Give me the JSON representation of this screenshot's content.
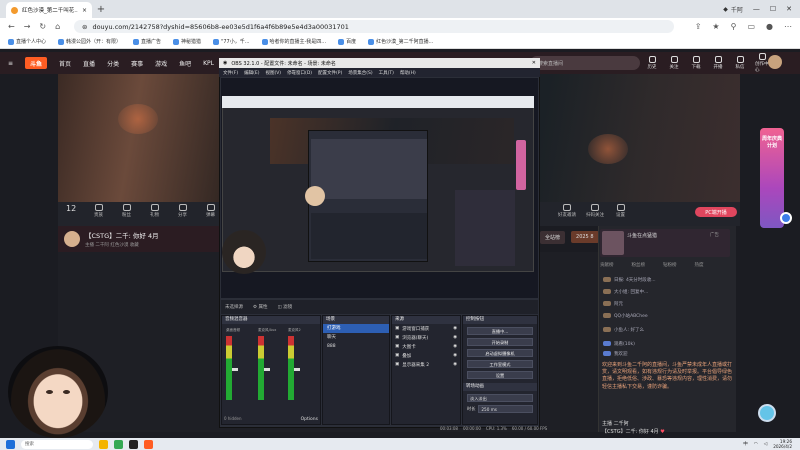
{
  "browser": {
    "tab_title": "红色沙漠_第二千叫花...",
    "url": "douyu.com/2142758?dyshid=85606b8-ee03e5d1f6a4f6b89e5e4d3a00031701",
    "account_label": "千阿",
    "bookmarks": [
      "直播个人中心",
      "韩漫公园外（开：有限）",
      "直播广告",
      "神秘猎猎",
      "\"77小，千...",
      "哈者你的直播主-我是四...",
      "百度",
      "红色沙漠_第二千阿直播..."
    ]
  },
  "site": {
    "logo": "斗鱼",
    "nav": [
      "首页",
      "直播",
      "分类",
      "赛事",
      "游戏",
      "鱼吧",
      "KPL"
    ],
    "search_placeholder": "搜索直播间",
    "nav_right": [
      "历史",
      "关注",
      "下载",
      "开播",
      "私信",
      "创作中心"
    ]
  },
  "toolbar": {
    "count": "12",
    "items": [
      "贵族",
      "粉丝",
      "礼物",
      "分享",
      "弹幕",
      "更多"
    ],
    "right_items": [
      "好友邀请",
      "扫码关注",
      "设置"
    ],
    "pc_button": "PC端开播"
  },
  "room": {
    "title": "【CSTG】二千: 你好 4月",
    "subtitle": "主播 二千阿   红色沙漠   收藏",
    "join_button": "全站榜",
    "badge": "2025 8"
  },
  "chat": {
    "ad_title": "斗鱼在点猛猎",
    "ad_tag": "广告",
    "tabs": [
      "贡献榜",
      "粉丝榜",
      "钻粉榜",
      "热度"
    ],
    "lines": [
      "日报: 4天分时段收...",
      "大小姐: 回复中...",
      "阿元",
      "QQ小站ABChee",
      "小鱼人: 好了么",
      "观看(10k)",
      "我欢迎"
    ],
    "notice": "欢迎来到斗鱼二千阿的直播间，斗鱼严禁未成年人直播或打赏，请文明观看，如有违规行为请及时举报。平台倡导绿色直播，拒绝低俗、涉政、暴恐等违规内容，理性消费，请勿轻信主播私下交易，谨防诈骗。",
    "user": "主播  二千阿",
    "message": "【CSTG】二千: 你好 4月"
  },
  "side_gift_text": "周年庆典计划",
  "obs": {
    "title": "OBS 32.1.0 - 配置文件: 未命名 - 场景: 未命名",
    "menu": [
      "文件(F)",
      "编辑(E)",
      "视图(V)",
      "停靠窗口(D)",
      "配置文件(P)",
      "场景集合(S)",
      "工具(T)",
      "帮助(H)"
    ],
    "tabs": [
      "未选择源",
      "属性",
      "滤镜"
    ],
    "mixer_title": "音频混音器",
    "meters": [
      "桌面音频",
      "麦克风/Aux",
      "麦克风2"
    ],
    "mixer_footer": "0 hidden",
    "mixer_options": "Options",
    "scenes_title": "场景",
    "scenes": [
      "打游戏",
      "聊天",
      "888"
    ],
    "sources_title": "来源",
    "sources": [
      "游戏窗口捕获",
      "浏览器(聊天)",
      "大图卡",
      "叠加",
      "显示器采集 2"
    ],
    "controls_title": "控制按钮",
    "controls": [
      "直播中...",
      "开始录制",
      "启动虚拟摄像机",
      "工作室模式",
      "设置"
    ],
    "transitions_title": "转场动画",
    "transition": "淡入淡出",
    "duration_label": "时长",
    "duration": "250 ms",
    "status": [
      "00:03:08",
      "00:00:00",
      "CPU: 1.3%",
      "60.00 / 60.00 FPS"
    ]
  },
  "taskbar": {
    "search": "搜索",
    "time": "19:26",
    "date": "2026/4/2",
    "lang": "中"
  },
  "colors": {
    "accent": "#ff5d23",
    "obs_select": "#2d5fb4",
    "pc_button": "#e0465e"
  }
}
